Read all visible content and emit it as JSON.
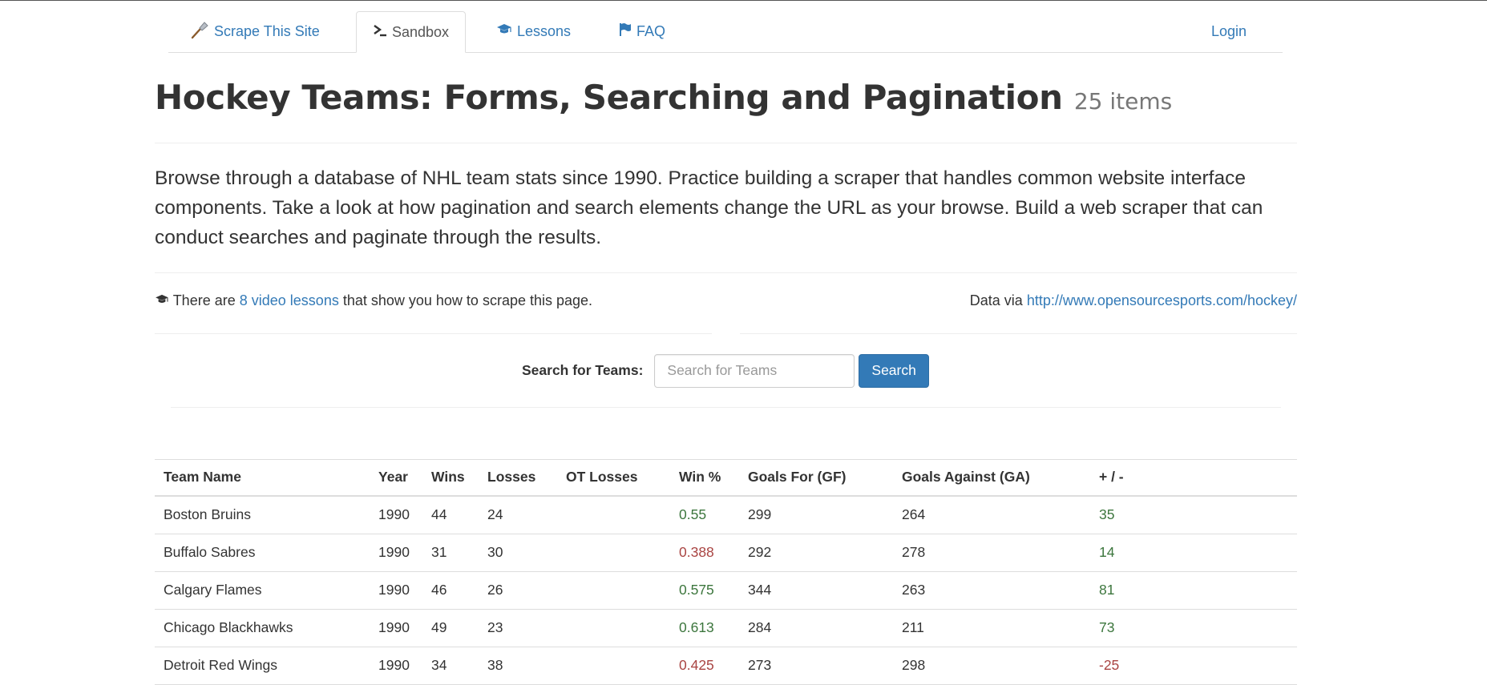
{
  "nav": {
    "brand": "Scrape This Site",
    "sandbox": "Sandbox",
    "lessons": "Lessons",
    "faq": "FAQ",
    "login": "Login"
  },
  "page": {
    "title": "Hockey Teams: Forms, Searching and Pagination",
    "count": "25 items",
    "description": "Browse through a database of NHL team stats since 1990. Practice building a scraper that handles common website interface components. Take a look at how pagination and search elements change the URL as your browse. Build a web scraper that can conduct searches and paginate through the results."
  },
  "lessons_note": {
    "prefix": "There are",
    "link_text": "8 video lessons",
    "suffix": "that show you how to scrape this page."
  },
  "credit": {
    "prefix": "Data via",
    "link_text": "http://www.opensourcesports.com/hockey/"
  },
  "search": {
    "label": "Search for Teams:",
    "placeholder": "Search for Teams",
    "value": "",
    "button": "Search"
  },
  "table": {
    "headers": [
      "Team Name",
      "Year",
      "Wins",
      "Losses",
      "OT Losses",
      "Win %",
      "Goals For (GF)",
      "Goals Against (GA)",
      "+ / -"
    ],
    "rows": [
      {
        "team": "Boston Bruins",
        "year": "1990",
        "wins": "44",
        "losses": "24",
        "ot_losses": "",
        "win_pct": "0.55",
        "gf": "299",
        "ga": "264",
        "diff": "35"
      },
      {
        "team": "Buffalo Sabres",
        "year": "1990",
        "wins": "31",
        "losses": "30",
        "ot_losses": "",
        "win_pct": "0.388",
        "gf": "292",
        "ga": "278",
        "diff": "14"
      },
      {
        "team": "Calgary Flames",
        "year": "1990",
        "wins": "46",
        "losses": "26",
        "ot_losses": "",
        "win_pct": "0.575",
        "gf": "344",
        "ga": "263",
        "diff": "81"
      },
      {
        "team": "Chicago Blackhawks",
        "year": "1990",
        "wins": "49",
        "losses": "23",
        "ot_losses": "",
        "win_pct": "0.613",
        "gf": "284",
        "ga": "211",
        "diff": "73"
      },
      {
        "team": "Detroit Red Wings",
        "year": "1990",
        "wins": "34",
        "losses": "38",
        "ot_losses": "",
        "win_pct": "0.425",
        "gf": "273",
        "ga": "298",
        "diff": "-25"
      }
    ]
  },
  "icons": {
    "brand": "spatula-icon",
    "sandbox": "terminal-icon",
    "lessons": "graduation-cap-icon",
    "faq": "flag-icon"
  },
  "colors": {
    "link": "#337ab7",
    "positive": "#3c763d",
    "negative": "#a94442",
    "button": "#337ab7"
  }
}
